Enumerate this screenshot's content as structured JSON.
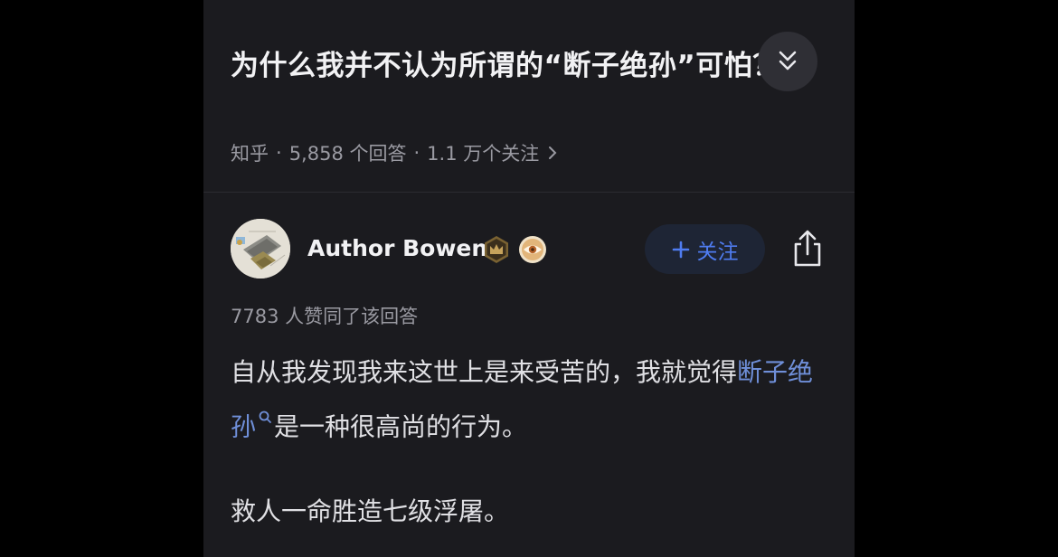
{
  "question": {
    "title": "为什么我并不认为所谓的“断子绝孙”可怕？",
    "source": "知乎",
    "separator": "·",
    "answer_count": "5,858 个回答",
    "follower_count": "1.1 万个关注"
  },
  "author": {
    "name": "Author Bowen",
    "follow_label": "关注"
  },
  "answer": {
    "vote_text": "7783 人赞同了该回答",
    "para1_start": "自从我发现我来这世上是来受苦的，我就觉得",
    "para1_link": "断子绝孙",
    "para1_end": "是一种很高尚的行为。",
    "para2": "救人一命胜造七级浮屠。"
  },
  "colors": {
    "background": "#1b1b1f",
    "title_text": "#f2f2f4",
    "secondary_text": "#9a9aa2",
    "link": "#6f8fd9",
    "accent": "#4f7cf0",
    "follow_bg": "#1e2535"
  },
  "icons": {
    "collapse": "double-chevron-down-icon",
    "meta_more": "chevron-right-icon",
    "badge1": "crown-badge-icon",
    "badge2": "eye-badge-icon",
    "follow": "plus-icon",
    "share": "share-icon",
    "link_search": "search-icon"
  }
}
